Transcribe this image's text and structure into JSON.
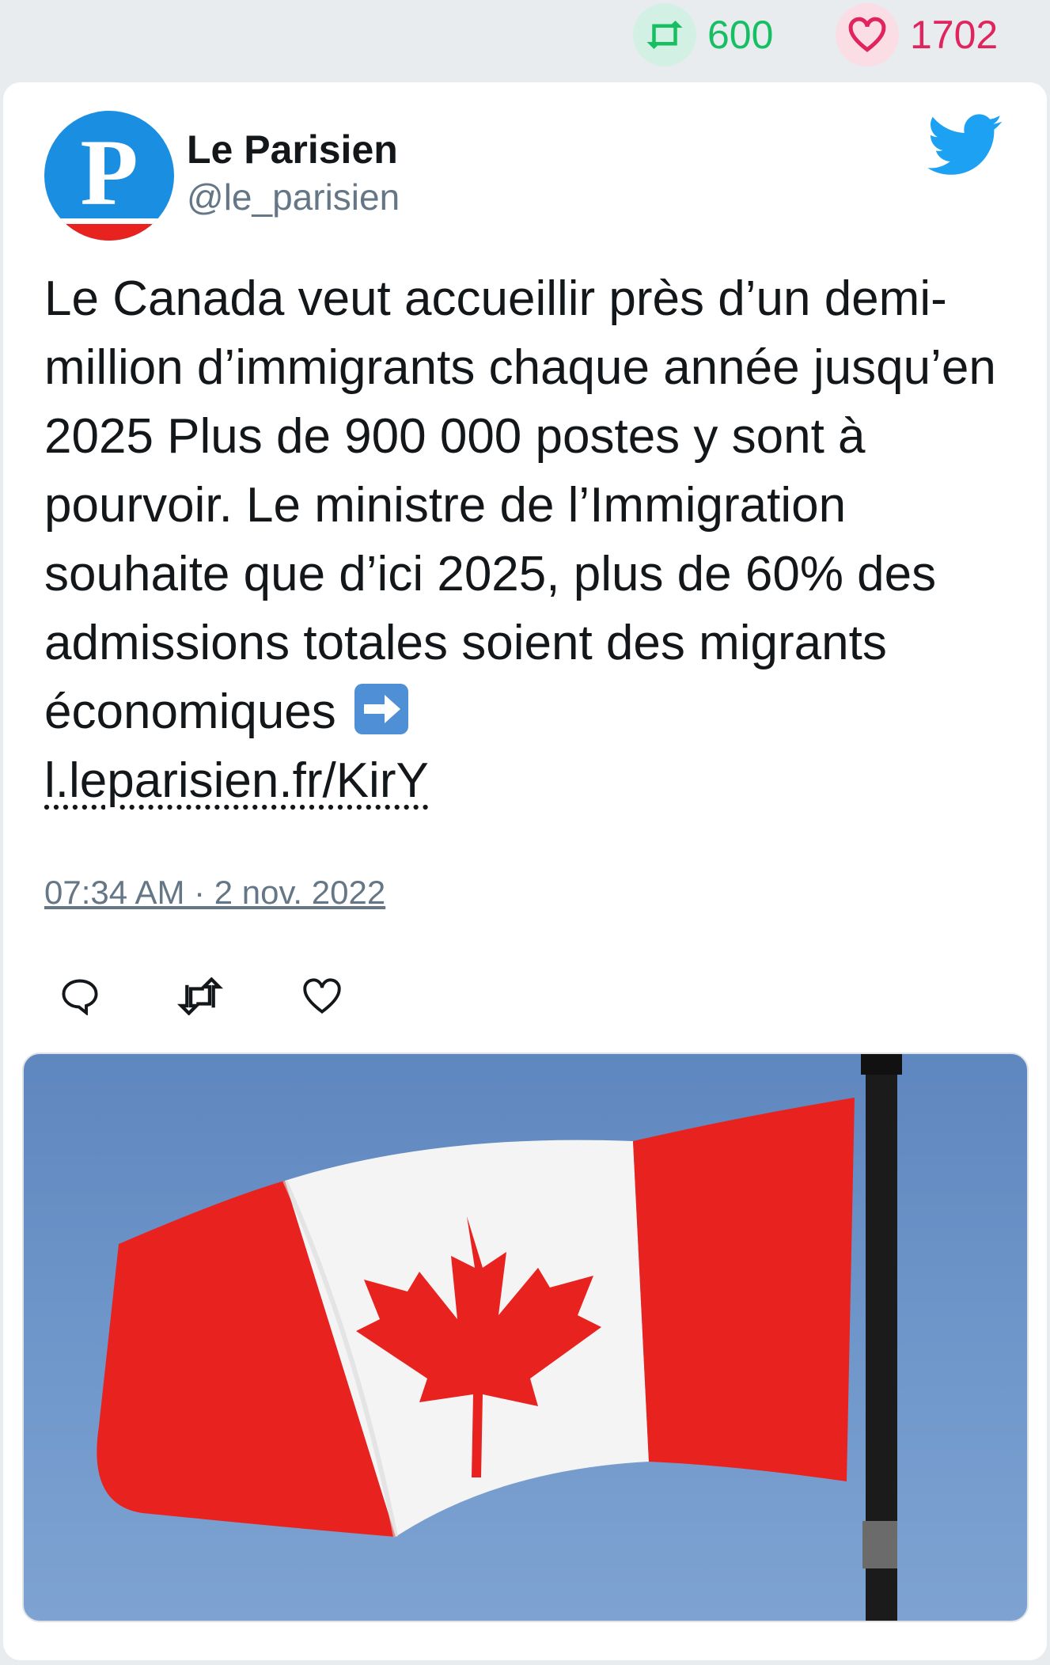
{
  "stats": {
    "retweets": "600",
    "likes": "1702"
  },
  "tweet": {
    "author_name": "Le Parisien",
    "handle": "@le_parisien",
    "avatar_letter": "P",
    "text": "Le Canada veut accueillir près d’un demi-million d’immigrants chaque année jusqu’en 2025 Plus de 900 000 postes y sont à pourvoir. Le ministre de l’Immigration souhaite que d’ici 2025, plus de 60% des admissions totales soient des migrants économiques",
    "link": "l.leparisien.fr/KirY",
    "timestamp": "07:34 AM · 2 nov. 2022"
  },
  "colors": {
    "retweet_green": "#17bf63",
    "like_red": "#e0245e",
    "twitter_blue": "#1da1f2",
    "flag_red": "#e8231f"
  },
  "icons": {
    "retweet": "retweet-icon",
    "like": "heart-icon",
    "reply": "reply-icon",
    "brand": "twitter-bird-icon",
    "arrow": "right-arrow-emoji"
  }
}
